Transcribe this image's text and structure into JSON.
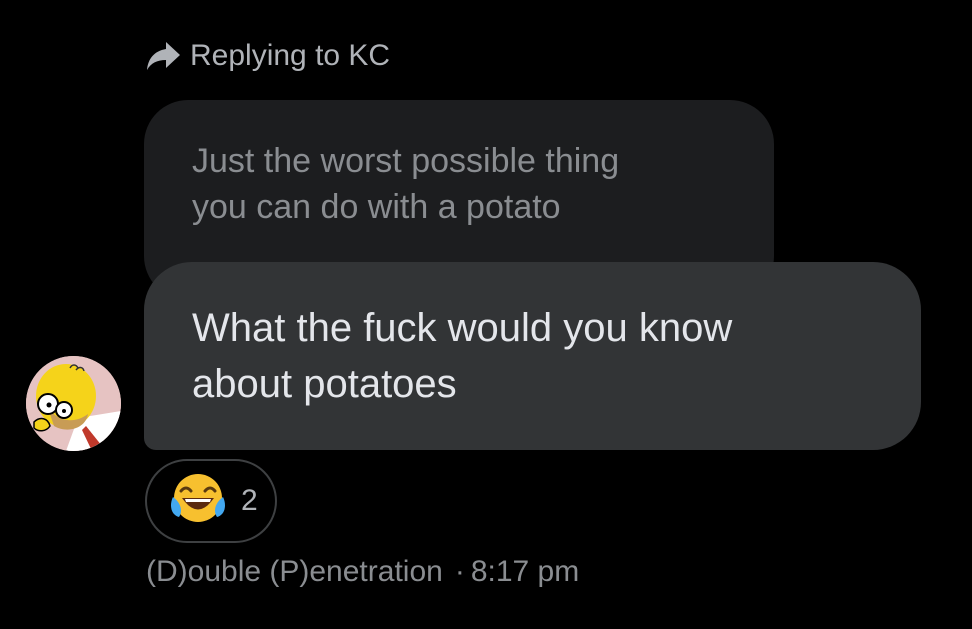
{
  "reply": {
    "icon": "reply-arrow-icon",
    "text": "Replying to KC"
  },
  "quoted_message": {
    "line1": "Just the worst possible thing",
    "line2": "you can do with a potato"
  },
  "message": {
    "line1": "What the fuck would you know",
    "line2": "about potatoes"
  },
  "avatar": {
    "icon": "homer-simpson-avatar"
  },
  "reaction": {
    "emoji_icon": "laughing-tears-emoji-icon",
    "count": "2"
  },
  "footer": {
    "sender": "(D)ouble (P)enetration",
    "separator": "·",
    "time": "8:17 pm"
  },
  "colors": {
    "background": "#000000",
    "quoted_bubble": "#1c1d1f",
    "message_bubble": "#323436",
    "secondary_text": "#8a8d91",
    "primary_text": "#e4e6eb"
  }
}
